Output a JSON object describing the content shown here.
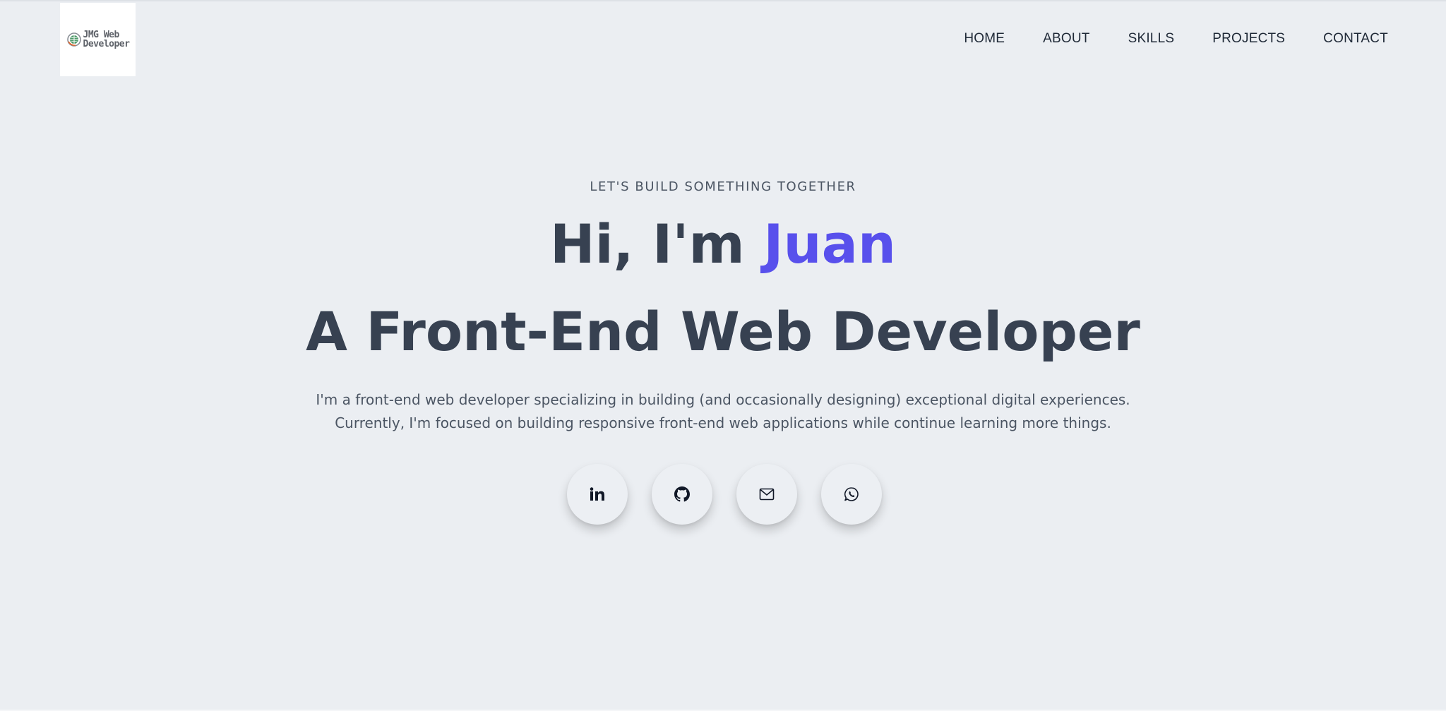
{
  "header": {
    "logo": {
      "line1": "JMG Web",
      "line2": "Developer"
    },
    "nav": [
      {
        "label": "HOME"
      },
      {
        "label": "ABOUT"
      },
      {
        "label": "SKILLS"
      },
      {
        "label": "PROJECTS"
      },
      {
        "label": "CONTACT"
      }
    ]
  },
  "hero": {
    "eyebrow": "LET'S BUILD SOMETHING TOGETHER",
    "greeting": "Hi, I'm ",
    "name": "Juan",
    "role": "A Front-End Web Developer",
    "intro_line1": "I'm a front-end web developer specializing in building (and occasionally designing) exceptional digital experiences.",
    "intro_line2": "Currently, I'm focused on building responsive front-end web applications while continue learning more things."
  },
  "socials": [
    {
      "icon": "linkedin-icon"
    },
    {
      "icon": "github-icon"
    },
    {
      "icon": "mail-icon"
    },
    {
      "icon": "whatsapp-icon"
    }
  ],
  "colors": {
    "background": "#ebeef2",
    "text": "#374151",
    "accent": "#5850ec"
  }
}
